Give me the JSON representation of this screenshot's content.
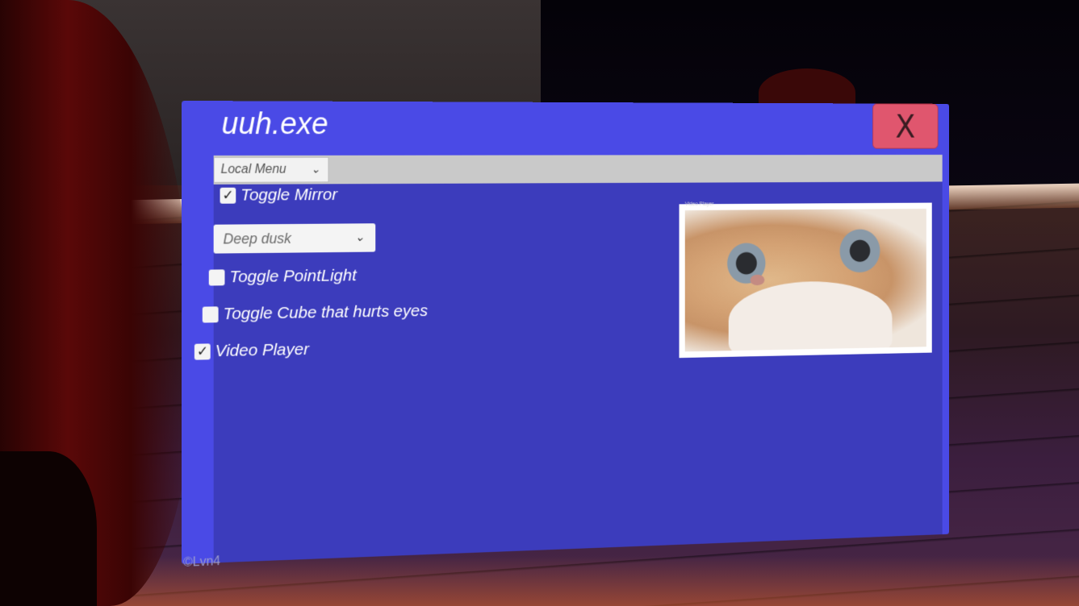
{
  "window": {
    "title": "uuh.exe",
    "close_label": "X"
  },
  "menu": {
    "selected": "Local Menu"
  },
  "controls": {
    "toggle_mirror": {
      "label": "Toggle Mirror",
      "checked": true
    },
    "skybox_dropdown": {
      "value": "Deep dusk"
    },
    "toggle_pointlight": {
      "label": "Toggle PointLight",
      "checked": false
    },
    "toggle_cube": {
      "label": "Toggle Cube that hurts eyes",
      "checked": false
    },
    "video_player": {
      "label": "Video Player",
      "checked": true
    }
  },
  "video": {
    "mini_label": "Video Player"
  },
  "footer": {
    "copyright": "©Lvn4"
  },
  "colors": {
    "frame": "#4a4ae6",
    "close": "#e0566e",
    "menubar": "#c9c9c9"
  }
}
